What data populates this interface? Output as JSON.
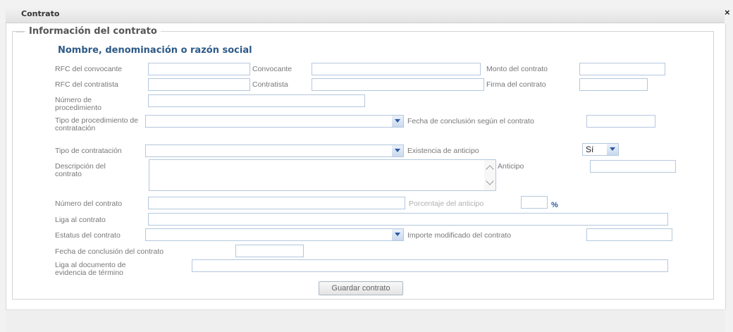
{
  "window": {
    "title": "Contrato",
    "close": "×"
  },
  "fieldset": {
    "legend": "Información del contrato",
    "subheading": "Nombre, denominación o razón social"
  },
  "labels": {
    "rfc_convocante": "RFC del convocante",
    "convocante": "Convocante",
    "monto": "Monto del contrato",
    "rfc_contratista": "RFC del contratista",
    "contratista": "Contratista",
    "firma": "Firma del contrato",
    "numero_procedimiento": "Número de procedimiento",
    "tipo_procedimiento": "Tipo de procedimiento de contratación",
    "fecha_conclusion_segun": "Fecha de conclusión según el contrato",
    "tipo_contratacion": "Tipo de contratación",
    "existencia_anticipo": "Existencia de anticipo",
    "descripcion": "Descripción del contrato",
    "anticipo": "Anticipo",
    "numero_contrato": "Número del contrato",
    "porcentaje_anticipo": "Porcentaje del anticipo",
    "percent_symbol": "%",
    "liga_contrato": "Liga al contrato",
    "estatus": "Estatus del contrato",
    "importe_modificado": "Importe modificado del contrato",
    "fecha_conclusion": "Fecha de conclusión del contrato",
    "liga_documento": "Liga al documento de evidencia de término"
  },
  "values": {
    "existencia_anticipo": "Sí"
  },
  "button": {
    "save": "Guardar contrato"
  }
}
